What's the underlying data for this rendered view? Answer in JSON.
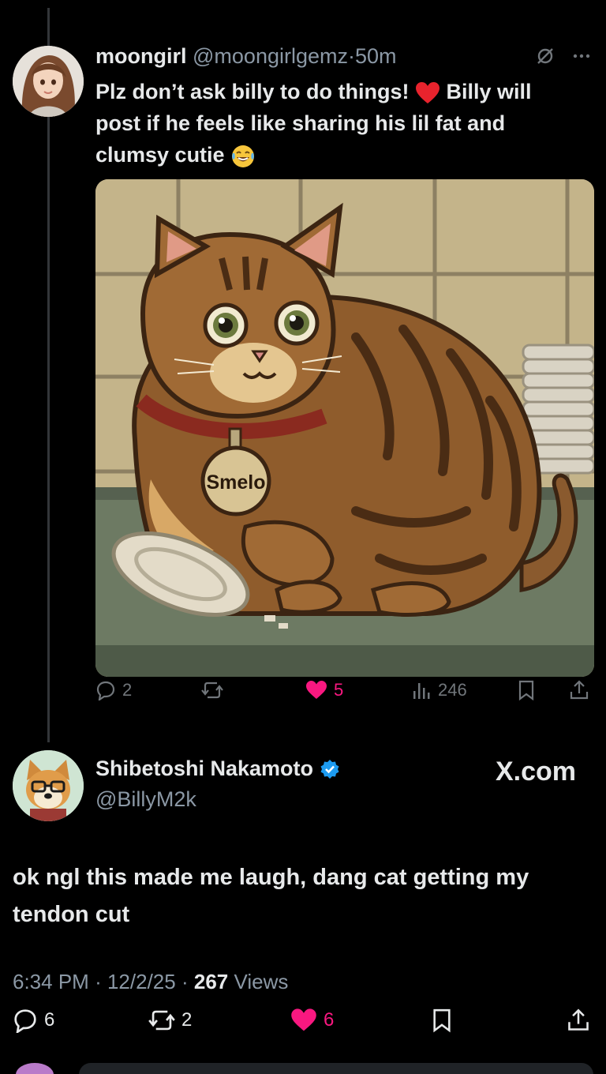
{
  "parent_post": {
    "display_name": "moongirl",
    "handle": "@moongirlgemz",
    "separator": "·",
    "time": "50m",
    "text_part1": "Plz don’t ask billy to do things!",
    "text_part2": "Billy will post if he feels like sharing his lil fat and clumsy cutie",
    "emoji_heart": "red-heart",
    "emoji_laugh": "tears-of-joy",
    "image_tag_text": "Smelo",
    "counts": {
      "replies": "2",
      "likes": "5",
      "views": "246"
    },
    "liked": true,
    "like_color": "#f91880"
  },
  "reply_post": {
    "display_name": "Shibetoshi Nakamoto",
    "handle": "@BillyM2k",
    "verified": true,
    "verified_color": "#1d9bf0",
    "watermark": "X.com",
    "text": "ok ngl this made me laugh, dang cat getting my tendon cut",
    "meta_time": "6:34 PM",
    "meta_sep1": "·",
    "meta_date": "12/2/25",
    "meta_sep2": "·",
    "meta_views_count": "267",
    "meta_views_label": "Views",
    "counts": {
      "replies": "6",
      "reposts": "2",
      "likes": "6"
    },
    "liked": true
  },
  "icons": [
    "mute-icon",
    "more-icon",
    "reply-icon",
    "repost-icon",
    "heart-icon",
    "views-icon",
    "bookmark-icon",
    "share-icon",
    "verified-badge-icon"
  ]
}
